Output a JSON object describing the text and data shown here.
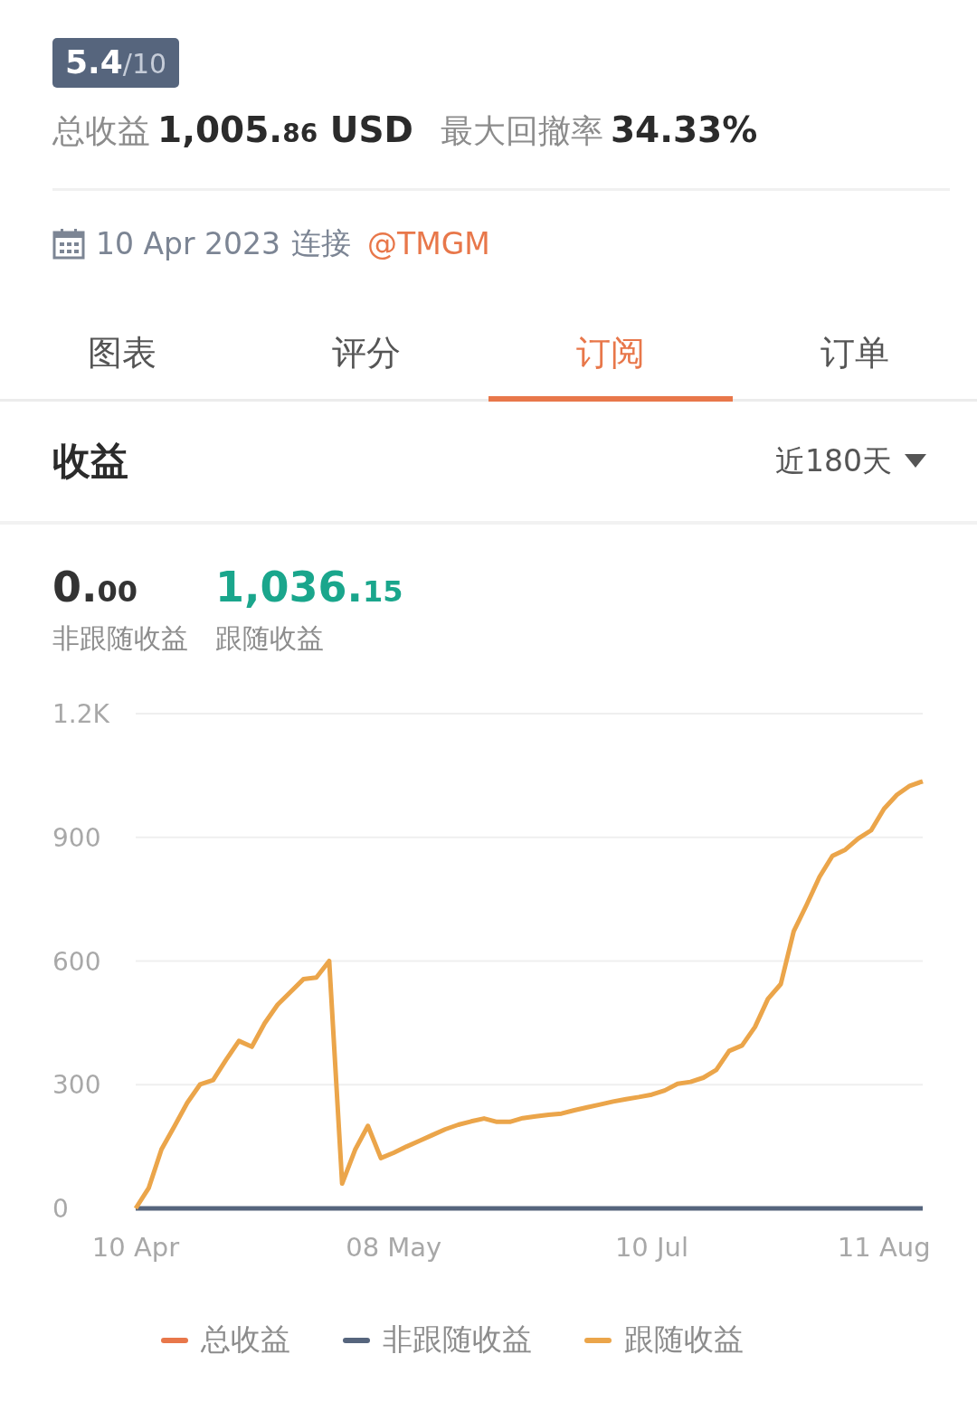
{
  "rating": {
    "score": "5.4",
    "scale": "/10"
  },
  "stats": [
    {
      "label": "总收益",
      "main": "1,005.",
      "decimals": "86",
      "unit": "USD"
    },
    {
      "label": "最大回撤率",
      "main": "34.33%"
    }
  ],
  "connection": {
    "date": "10 Apr 2023",
    "text": "连接",
    "broker": "@TMGM"
  },
  "tabs": [
    {
      "label": "图表",
      "selected": false
    },
    {
      "label": "评分",
      "selected": false
    },
    {
      "label": "订阅",
      "selected": true
    },
    {
      "label": "订单",
      "selected": false
    }
  ],
  "section": {
    "title": "收益",
    "period": "近180天"
  },
  "summary": [
    {
      "main": "0.",
      "decimals": "00",
      "label": "非跟随收益",
      "color": "#333333"
    },
    {
      "main": "1,036.",
      "decimals": "15",
      "label": "跟随收益",
      "color": "#1aa68c"
    }
  ],
  "chart_data": {
    "type": "line",
    "categories": [
      "10 Apr",
      null,
      null,
      null,
      null,
      null,
      null,
      null,
      null,
      null,
      null,
      null,
      null,
      null,
      null,
      null,
      null,
      null,
      null,
      null,
      "08 May",
      null,
      null,
      null,
      null,
      null,
      null,
      null,
      null,
      null,
      null,
      null,
      null,
      null,
      null,
      null,
      null,
      null,
      null,
      null,
      "10 Jul",
      null,
      null,
      null,
      null,
      null,
      null,
      null,
      null,
      null,
      null,
      null,
      null,
      null,
      null,
      null,
      null,
      null,
      "11 Aug",
      null,
      null,
      null
    ],
    "series": [
      {
        "name": "总收益",
        "color": "#e8774a",
        "values": [
          null,
          null,
          null,
          null,
          null,
          null,
          null,
          null,
          null,
          null,
          null,
          null,
          null,
          null,
          null,
          null,
          null,
          null,
          null,
          null,
          null,
          null,
          null,
          null,
          null,
          null,
          null,
          null,
          null,
          null,
          null,
          null,
          null,
          null,
          null,
          null,
          null,
          null,
          null,
          null,
          null,
          null,
          null,
          null,
          null,
          null,
          null,
          null,
          null,
          null,
          null,
          null,
          null,
          null,
          null,
          null,
          null,
          null,
          null,
          null,
          null,
          null
        ]
      },
      {
        "name": "非跟随收益",
        "color": "#56657d",
        "values": [
          0,
          0,
          0,
          0,
          0,
          0,
          0,
          0,
          0,
          0,
          0,
          0,
          0,
          0,
          0,
          0,
          0,
          0,
          0,
          0,
          0,
          0,
          0,
          0,
          0,
          0,
          0,
          0,
          0,
          0,
          0,
          0,
          0,
          0,
          0,
          0,
          0,
          0,
          0,
          0,
          0,
          0,
          0,
          0,
          0,
          0,
          0,
          0,
          0,
          0,
          0,
          0,
          0,
          0,
          0,
          0,
          0,
          0,
          0,
          0,
          0,
          0
        ]
      },
      {
        "name": "跟随收益",
        "color": "#eba54a",
        "values": [
          0,
          49,
          143,
          199,
          256,
          301,
          311,
          360,
          406,
          392,
          449,
          494,
          525,
          556,
          560,
          600,
          60,
          142,
          200,
          122,
          135,
          150,
          164,
          178,
          192,
          203,
          211,
          218,
          210,
          210,
          219,
          223,
          227,
          230,
          238,
          245,
          252,
          259,
          265,
          270,
          276,
          286,
          302,
          307,
          317,
          336,
          382,
          395,
          440,
          508,
          544,
          672,
          736,
          804,
          855,
          870,
          897,
          917,
          969,
          1003,
          1025,
          1036
        ]
      }
    ],
    "ylim": [
      0,
      1200
    ],
    "grid": true,
    "yticks": [
      0,
      300,
      600,
      900,
      {
        "value": 1200,
        "label": "1.2K"
      }
    ]
  }
}
